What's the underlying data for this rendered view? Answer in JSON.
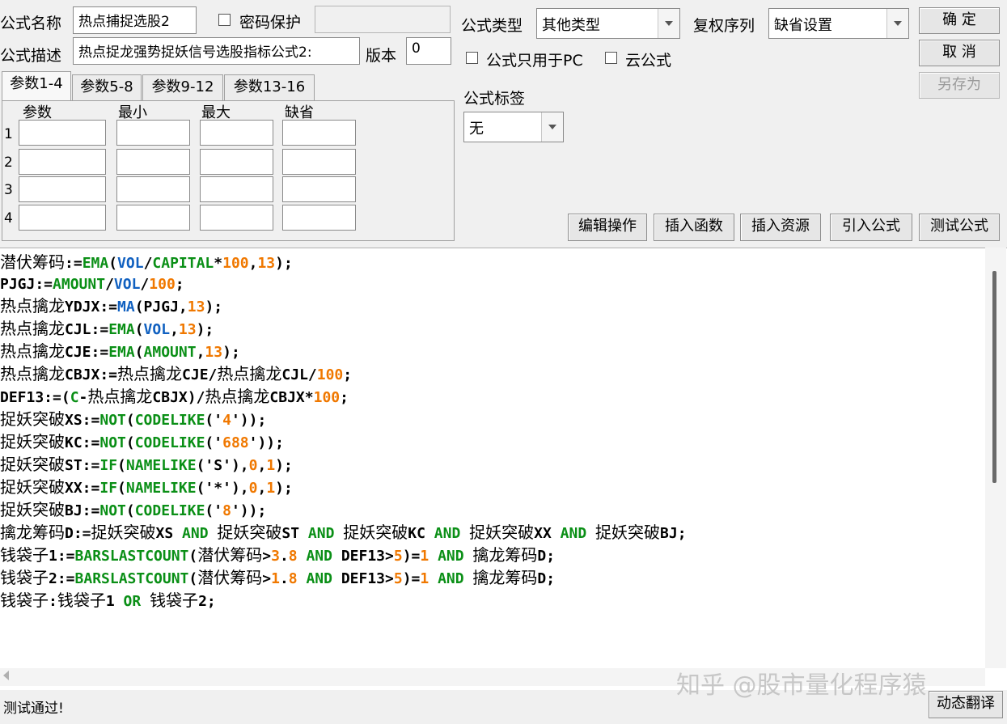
{
  "form": {
    "name_label": "公式名称",
    "name_value": "热点捕捉选股2",
    "password_label": "密码保护",
    "desc_label": "公式描述",
    "desc_value": "热点捉龙强势捉妖信号选股指标公式2:",
    "version_label": "版本",
    "version_value": "0",
    "type_label": "公式类型",
    "type_value": "其他类型",
    "rights_label": "复权序列",
    "rights_value": "缺省设置",
    "pc_only_label": "公式只用于PC",
    "cloud_label": "云公式",
    "tag_label": "公式标签",
    "tag_value": "无"
  },
  "buttons": {
    "ok": "确 定",
    "cancel": "取 消",
    "save_as": "另存为",
    "edit": "编辑操作",
    "insert_func": "插入函数",
    "insert_res": "插入资源",
    "import": "引入公式",
    "test": "测试公式",
    "translate": "动态翻译"
  },
  "tabs": [
    "参数1-4",
    "参数5-8",
    "参数9-12",
    "参数13-16"
  ],
  "params": {
    "headers": [
      "参数",
      "最小",
      "最大",
      "缺省"
    ],
    "rows": [
      "1",
      "2",
      "3",
      "4"
    ]
  },
  "code": [
    [
      [
        "cn",
        "潜伏筹码"
      ],
      [
        "t",
        ":="
      ],
      [
        "kw",
        "EMA"
      ],
      [
        "t",
        "("
      ],
      [
        "vol",
        "VOL"
      ],
      [
        "t",
        "/"
      ],
      [
        "kw",
        "CAPITAL"
      ],
      [
        "t",
        "*"
      ],
      [
        "num",
        "100"
      ],
      [
        "t",
        ","
      ],
      [
        "num",
        "13"
      ],
      [
        "t",
        ");"
      ]
    ],
    [
      [
        "t",
        "PJGJ:="
      ],
      [
        "kw",
        "AMOUNT"
      ],
      [
        "t",
        "/"
      ],
      [
        "vol",
        "VOL"
      ],
      [
        "t",
        "/"
      ],
      [
        "num",
        "100"
      ],
      [
        "t",
        ";"
      ]
    ],
    [
      [
        "cn",
        "热点擒龙"
      ],
      [
        "t",
        "YDJX:="
      ],
      [
        "vol",
        "MA"
      ],
      [
        "t",
        "(PJGJ,"
      ],
      [
        "num",
        "13"
      ],
      [
        "t",
        ");"
      ]
    ],
    [
      [
        "cn",
        "热点擒龙"
      ],
      [
        "t",
        "CJL:="
      ],
      [
        "kw",
        "EMA"
      ],
      [
        "t",
        "("
      ],
      [
        "vol",
        "VOL"
      ],
      [
        "t",
        ","
      ],
      [
        "num",
        "13"
      ],
      [
        "t",
        ");"
      ]
    ],
    [
      [
        "cn",
        "热点擒龙"
      ],
      [
        "t",
        "CJE:="
      ],
      [
        "kw",
        "EMA"
      ],
      [
        "t",
        "("
      ],
      [
        "kw",
        "AMOUNT"
      ],
      [
        "t",
        ","
      ],
      [
        "num",
        "13"
      ],
      [
        "t",
        ");"
      ]
    ],
    [
      [
        "cn",
        "热点擒龙"
      ],
      [
        "t",
        "CBJX:="
      ],
      [
        "cn",
        "热点擒龙"
      ],
      [
        "t",
        "CJE/"
      ],
      [
        "cn",
        "热点擒龙"
      ],
      [
        "t",
        "CJL/"
      ],
      [
        "num",
        "100"
      ],
      [
        "t",
        ";"
      ]
    ],
    [
      [
        "t",
        "DEF13:=("
      ],
      [
        "kw",
        "C"
      ],
      [
        "t",
        "-"
      ],
      [
        "cn",
        "热点擒龙"
      ],
      [
        "t",
        "CBJX)/"
      ],
      [
        "cn",
        "热点擒龙"
      ],
      [
        "t",
        "CBJX*"
      ],
      [
        "num",
        "100"
      ],
      [
        "t",
        ";"
      ]
    ],
    [
      [
        "cn",
        "捉妖突破"
      ],
      [
        "t",
        "XS:="
      ],
      [
        "kw",
        "NOT"
      ],
      [
        "t",
        "("
      ],
      [
        "kw",
        "CODELIKE"
      ],
      [
        "t",
        "('"
      ],
      [
        "num",
        "4"
      ],
      [
        "t",
        "'));"
      ]
    ],
    [
      [
        "cn",
        "捉妖突破"
      ],
      [
        "t",
        "KC:="
      ],
      [
        "kw",
        "NOT"
      ],
      [
        "t",
        "("
      ],
      [
        "kw",
        "CODELIKE"
      ],
      [
        "t",
        "('"
      ],
      [
        "num",
        "688"
      ],
      [
        "t",
        "'));"
      ]
    ],
    [
      [
        "cn",
        "捉妖突破"
      ],
      [
        "t",
        "ST:="
      ],
      [
        "kw",
        "IF"
      ],
      [
        "t",
        "("
      ],
      [
        "kw",
        "NAMELIKE"
      ],
      [
        "t",
        "('S'),"
      ],
      [
        "num",
        "0"
      ],
      [
        "t",
        ","
      ],
      [
        "num",
        "1"
      ],
      [
        "t",
        ");"
      ]
    ],
    [
      [
        "cn",
        "捉妖突破"
      ],
      [
        "t",
        "XX:="
      ],
      [
        "kw",
        "IF"
      ],
      [
        "t",
        "("
      ],
      [
        "kw",
        "NAMELIKE"
      ],
      [
        "t",
        "('*'),"
      ],
      [
        "num",
        "0"
      ],
      [
        "t",
        ","
      ],
      [
        "num",
        "1"
      ],
      [
        "t",
        ");"
      ]
    ],
    [
      [
        "cn",
        "捉妖突破"
      ],
      [
        "t",
        "BJ:="
      ],
      [
        "kw",
        "NOT"
      ],
      [
        "t",
        "("
      ],
      [
        "kw",
        "CODELIKE"
      ],
      [
        "t",
        "('"
      ],
      [
        "num",
        "8"
      ],
      [
        "t",
        "'));"
      ]
    ],
    [
      [
        "cn",
        "擒龙筹码"
      ],
      [
        "t",
        "D:="
      ],
      [
        "cn",
        "捉妖突破"
      ],
      [
        "t",
        "XS "
      ],
      [
        "kw",
        "AND"
      ],
      [
        "t",
        " "
      ],
      [
        "cn",
        "捉妖突破"
      ],
      [
        "t",
        "ST "
      ],
      [
        "kw",
        "AND"
      ],
      [
        "t",
        " "
      ],
      [
        "cn",
        "捉妖突破"
      ],
      [
        "t",
        "KC "
      ],
      [
        "kw",
        "AND"
      ],
      [
        "t",
        " "
      ],
      [
        "cn",
        "捉妖突破"
      ],
      [
        "t",
        "XX "
      ],
      [
        "kw",
        "AND"
      ],
      [
        "t",
        " "
      ],
      [
        "cn",
        "捉妖突破"
      ],
      [
        "t",
        "BJ;"
      ]
    ],
    [
      [
        "cn",
        "钱袋子"
      ],
      [
        "t",
        "1:="
      ],
      [
        "kw",
        "BARSLASTCOUNT"
      ],
      [
        "t",
        "("
      ],
      [
        "cn",
        "潜伏筹码"
      ],
      [
        "t",
        ">"
      ],
      [
        "num",
        "3"
      ],
      [
        "t",
        "."
      ],
      [
        "num",
        "8"
      ],
      [
        "t",
        " "
      ],
      [
        "kw",
        "AND"
      ],
      [
        "t",
        " DEF13>"
      ],
      [
        "num",
        "5"
      ],
      [
        "t",
        ")="
      ],
      [
        "num",
        "1"
      ],
      [
        "t",
        " "
      ],
      [
        "kw",
        "AND"
      ],
      [
        "t",
        " "
      ],
      [
        "cn",
        "擒龙筹码"
      ],
      [
        "t",
        "D;"
      ]
    ],
    [
      [
        "cn",
        "钱袋子"
      ],
      [
        "t",
        "2:="
      ],
      [
        "kw",
        "BARSLASTCOUNT"
      ],
      [
        "t",
        "("
      ],
      [
        "cn",
        "潜伏筹码"
      ],
      [
        "t",
        ">"
      ],
      [
        "num",
        "1"
      ],
      [
        "t",
        "."
      ],
      [
        "num",
        "8"
      ],
      [
        "t",
        " "
      ],
      [
        "kw",
        "AND"
      ],
      [
        "t",
        " DEF13>"
      ],
      [
        "num",
        "5"
      ],
      [
        "t",
        ")="
      ],
      [
        "num",
        "1"
      ],
      [
        "t",
        " "
      ],
      [
        "kw",
        "AND"
      ],
      [
        "t",
        " "
      ],
      [
        "cn",
        "擒龙筹码"
      ],
      [
        "t",
        "D;"
      ]
    ],
    [
      [
        "cn",
        "钱袋子"
      ],
      [
        "t",
        ":"
      ],
      [
        "cn",
        "钱袋子"
      ],
      [
        "t",
        "1 "
      ],
      [
        "kw",
        "OR"
      ],
      [
        "t",
        " "
      ],
      [
        "cn",
        "钱袋子"
      ],
      [
        "t",
        "2;"
      ]
    ]
  ],
  "status": "测试通过!",
  "watermark": "知乎 @股市量化程序猿"
}
